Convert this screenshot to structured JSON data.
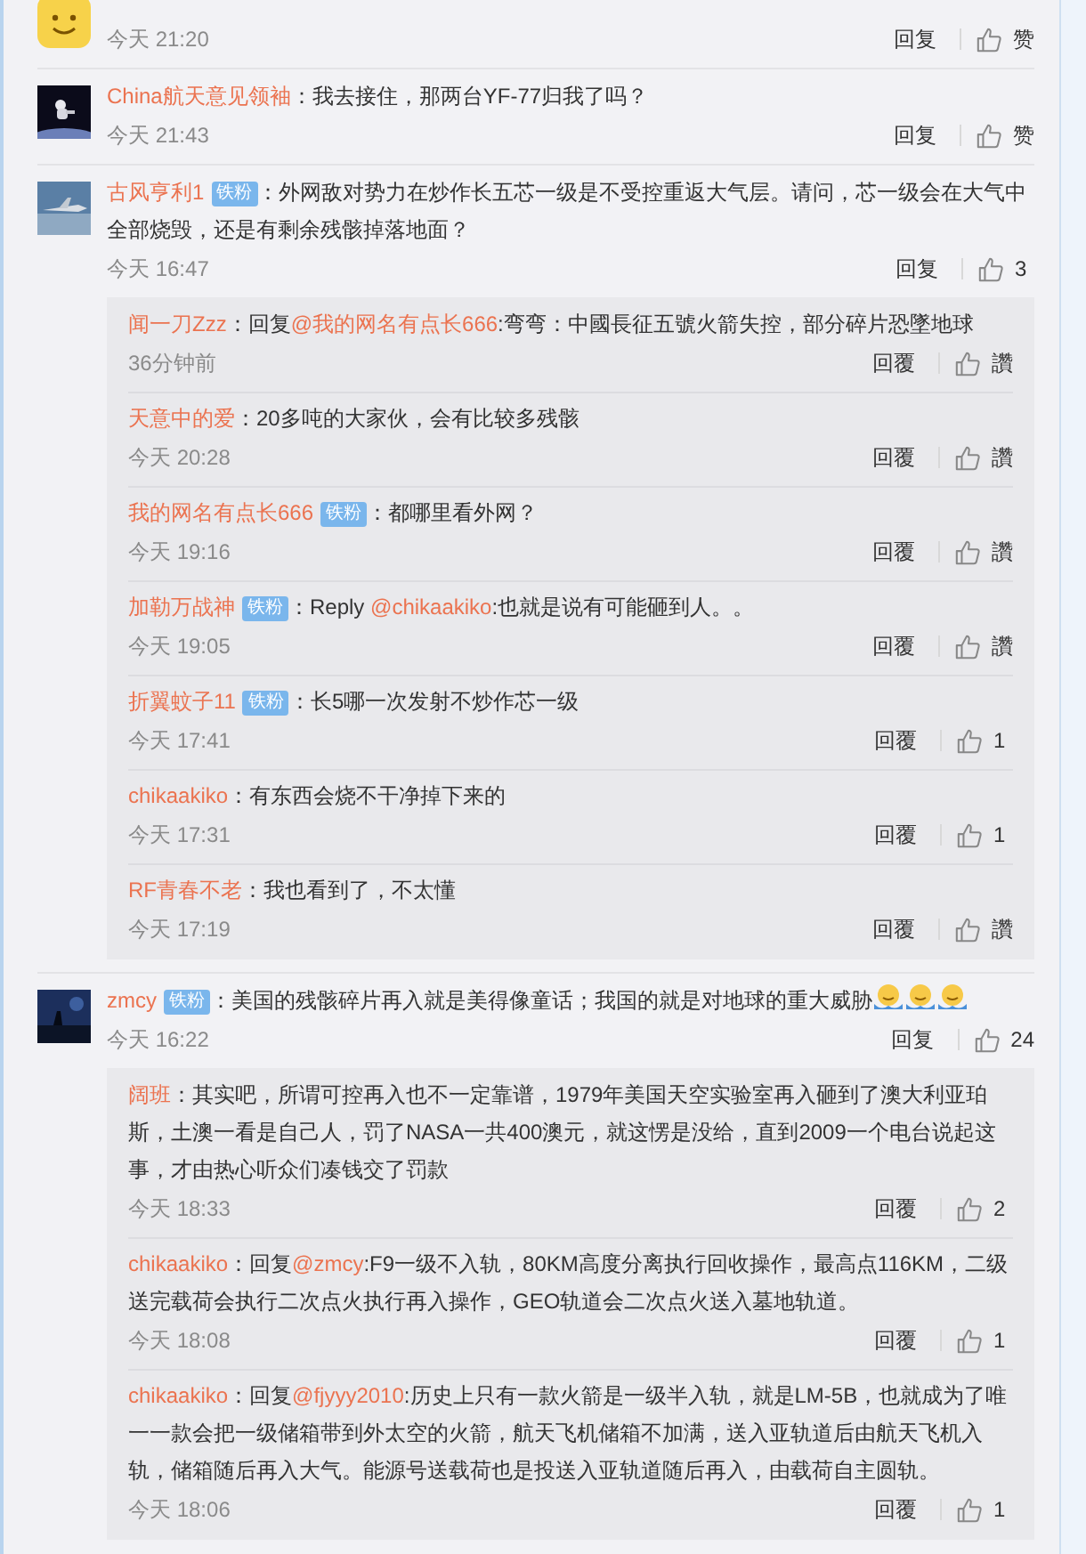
{
  "comments": [
    {
      "avatar": {
        "kind": "icon"
      },
      "time": "今天 21:20",
      "reply_label": "回复",
      "like_label": "赞"
    },
    {
      "avatar": {
        "kind": "picture"
      },
      "name": "China航天意见领袖",
      "segments": [
        {
          "text": "：我去接住，那两台YF-77归我了吗？",
          "kind": "text"
        }
      ],
      "time": "今天 21:43",
      "reply_label": "回复",
      "like_label": "赞"
    },
    {
      "avatar": {
        "kind": "picture"
      },
      "name": "古风亨利1",
      "fan_badge": "铁粉",
      "segments": [
        {
          "text": "：外网敌对势力在炒作长五芯一级是不受控重返大气层。请问，芯一级会在大气中全部烧毁，还是有剩余残骸掉落地面？",
          "kind": "text"
        }
      ],
      "time": "今天 16:47",
      "reply_label": "回复",
      "like_label": "3",
      "replies": [
        {
          "name": "闻一刀Zzz",
          "segments": [
            {
              "text": "：回复",
              "kind": "text"
            },
            {
              "text": "@我的网名有点长666",
              "kind": "mention"
            },
            {
              "text": ":弯弯：中國長征五號火箭失控，部分碎片恐墜地球",
              "kind": "text"
            }
          ],
          "time": "36分钟前",
          "reply_label": "回覆",
          "like_label": "讚"
        },
        {
          "name": "天意中的爱",
          "segments": [
            {
              "text": "：20多吨的大家伙，会有比较多残骸",
              "kind": "text"
            }
          ],
          "time": "今天 20:28",
          "reply_label": "回覆",
          "like_label": "讚"
        },
        {
          "name": "我的网名有点长666",
          "fan_badge": "铁粉",
          "segments": [
            {
              "text": "：都哪里看外网？",
              "kind": "text"
            }
          ],
          "time": "今天 19:16",
          "reply_label": "回覆",
          "like_label": "讚"
        },
        {
          "name": "加勒万战神",
          "fan_badge": "铁粉",
          "segments": [
            {
              "text": "：Reply ",
              "kind": "text"
            },
            {
              "text": "@chikaakiko",
              "kind": "mention"
            },
            {
              "text": ":也就是说有可能砸到人。。",
              "kind": "text"
            }
          ],
          "time": "今天 19:05",
          "reply_label": "回覆",
          "like_label": "讚"
        },
        {
          "name": "折翼蚊子11",
          "fan_badge": "铁粉",
          "segments": [
            {
              "text": "：长5哪一次发射不炒作芯一级",
              "kind": "text"
            }
          ],
          "time": "今天 17:41",
          "reply_label": "回覆",
          "like_label": "1"
        },
        {
          "name": "chikaakiko",
          "segments": [
            {
              "text": "：有东西会烧不干净掉下来的",
              "kind": "text"
            }
          ],
          "time": "今天 17:31",
          "reply_label": "回覆",
          "like_label": "1"
        },
        {
          "name": "RF青春不老",
          "segments": [
            {
              "text": "：我也看到了，不太懂",
              "kind": "text"
            }
          ],
          "time": "今天 17:19",
          "reply_label": "回覆",
          "like_label": "讚"
        }
      ]
    },
    {
      "avatar": {
        "kind": "picture"
      },
      "name": "zmcy",
      "fan_badge": "铁粉",
      "segments": [
        {
          "text": "：美国的残骸碎片再入就是美得像童话；我国的就是对地球的重大威胁",
          "kind": "text"
        }
      ],
      "emojis": [
        {
          "kind": "icon"
        },
        {
          "kind": "icon"
        },
        {
          "kind": "icon"
        }
      ],
      "time": "今天 16:22",
      "reply_label": "回复",
      "like_label": "24",
      "replies": [
        {
          "name": "阔班",
          "segments": [
            {
              "text": "：其实吧，所谓可控再入也不一定靠谱，1979年美国天空实验室再入砸到了澳大利亚珀斯，土澳一看是自己人，罚了NASA一共400澳元，就这愣是没给，直到2009一个电台说起这事，才由热心听众们凑钱交了罚款",
              "kind": "text"
            }
          ],
          "time": "今天 18:33",
          "reply_label": "回覆",
          "like_label": "2"
        },
        {
          "name": "chikaakiko",
          "segments": [
            {
              "text": "：回复",
              "kind": "text"
            },
            {
              "text": "@zmcy",
              "kind": "mention"
            },
            {
              "text": ":F9一级不入轨，80KM高度分离执行回收操作，最高点116KM，二级送完载荷会执行二次点火执行再入操作，GEO轨道会二次点火送入墓地轨道。",
              "kind": "text"
            }
          ],
          "time": "今天 18:08",
          "reply_label": "回覆",
          "like_label": "1"
        },
        {
          "name": "chikaakiko",
          "segments": [
            {
              "text": "：回复",
              "kind": "text"
            },
            {
              "text": "@fjyyy2010",
              "kind": "mention"
            },
            {
              "text": ":历史上只有一款火箭是一级半入轨，就是LM-5B，也就成为了唯一一款会把一级储箱带到外太空的火箭，航天飞机储箱不加满，送入亚轨道后由航天飞机入轨，储箱随后再入大气。能源号送载荷也是投送入亚轨道随后再入，由载荷自主圆轨。",
              "kind": "text"
            }
          ],
          "time": "今天 18:06",
          "reply_label": "回覆",
          "like_label": "1"
        }
      ]
    }
  ]
}
